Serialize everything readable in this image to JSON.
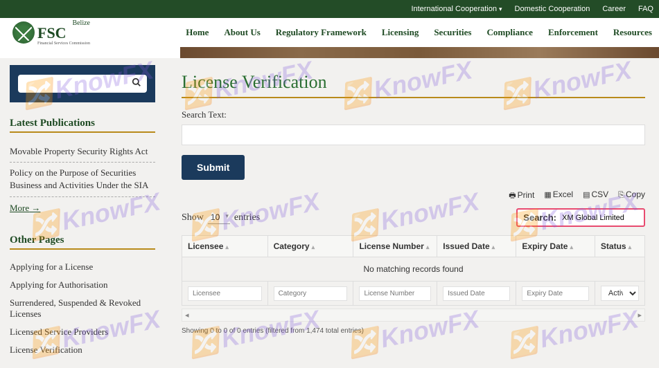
{
  "topbar": {
    "intl": "International Cooperation",
    "domestic": "Domestic Cooperation",
    "career": "Career",
    "faq": "FAQ"
  },
  "logo": {
    "country": "Belize",
    "abbr": "FSC",
    "full": "Financial Services Commission"
  },
  "nav": {
    "home": "Home",
    "about": "About Us",
    "rf": "Regulatory Framework",
    "licensing": "Licensing",
    "securities": "Securities",
    "compliance": "Compliance",
    "enforcement": "Enforcement",
    "resources": "Resources"
  },
  "sidebar": {
    "latest_title": "Latest Publications",
    "pub1": "Movable Property Security Rights Act",
    "pub2": "Policy on the Purpose of Securities Business and Activities Under the SIA",
    "more": "More",
    "other_title": "Other Pages",
    "op1": "Applying for a License",
    "op2": "Applying for Authorisation",
    "op3": "Surrendered, Suspended & Revoked Licenses",
    "op4": "Licensed Service Providers",
    "op5": "License Verification"
  },
  "page": {
    "title": "License Verification",
    "search_label": "Search Text:",
    "submit": "Submit"
  },
  "export": {
    "print": "Print",
    "excel": "Excel",
    "csv": "CSV",
    "copy": "Copy"
  },
  "table": {
    "show": "Show",
    "entries": "entries",
    "entries_count": "10",
    "search_label": "Search:",
    "search_value": "XM Global Limited",
    "cols": {
      "licensee": "Licensee",
      "category": "Category",
      "license_number": "License Number",
      "issued": "Issued Date",
      "expiry": "Expiry Date",
      "status": "Status"
    },
    "no_data": "No matching records found",
    "filter_ph": {
      "licensee": "Licensee",
      "category": "Category",
      "license_number": "License Number",
      "issued": "Issued Date",
      "expiry": "Expiry Date"
    },
    "status_option": "Active",
    "info": "Showing 0 to 0 of 0 entries (filtered from 1,474 total entries)"
  },
  "watermark": "KnowFX"
}
